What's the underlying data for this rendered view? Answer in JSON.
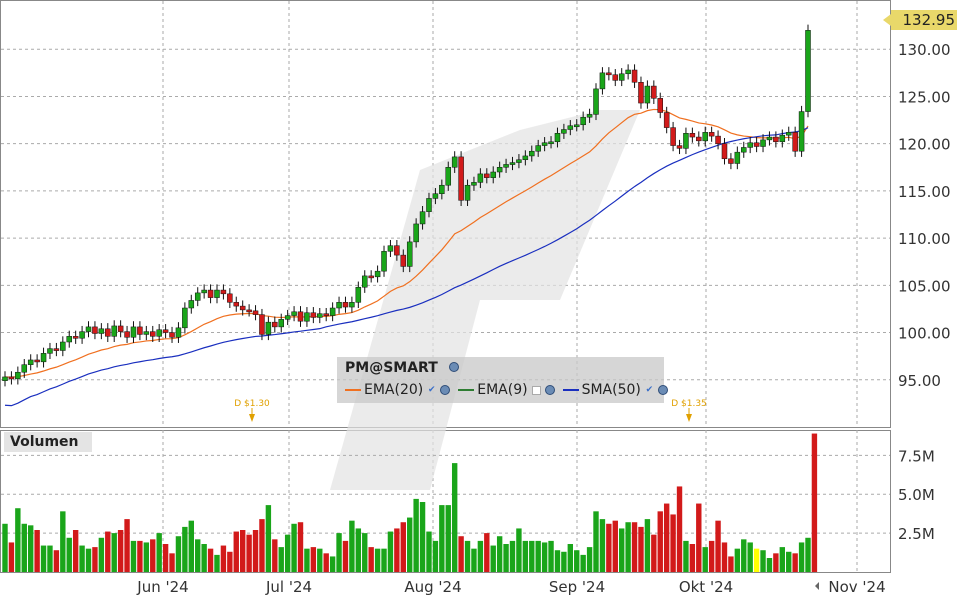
{
  "chart_data": [
    {
      "type": "candlestick",
      "symbol": "PM@SMART",
      "last_price_label": "132.95",
      "ylim": [
        90,
        135
      ],
      "y_ticks": [
        "95.00",
        "100.00",
        "105.00",
        "110.00",
        "115.00",
        "120.00",
        "125.00",
        "130.00"
      ],
      "x_ticks": [
        "Jun '24",
        "Jul '24",
        "Aug '24",
        "Sep '24",
        "Okt '24",
        "Nov '24"
      ],
      "series": [
        {
          "name": "EMA(20)",
          "color": "#f07020",
          "checked": true
        },
        {
          "name": "EMA(9)",
          "color": "#2e7d32",
          "checked": false
        },
        {
          "name": "SMA(50)",
          "color": "#1a2fbf",
          "checked": true
        }
      ],
      "dividends": [
        "D $1.30",
        "D $1.35"
      ],
      "closes": [
        95.3,
        95.1,
        95.8,
        96.6,
        97.1,
        96.9,
        97.8,
        98.3,
        98.1,
        99.0,
        99.6,
        99.4,
        100.1,
        100.6,
        99.9,
        100.4,
        99.6,
        100.7,
        100.1,
        99.5,
        100.6,
        99.8,
        100.1,
        99.6,
        100.3,
        100.0,
        99.5,
        100.5,
        102.6,
        103.4,
        104.2,
        104.5,
        103.7,
        104.5,
        104.1,
        103.2,
        102.8,
        102.4,
        102.3,
        101.9,
        99.8,
        101.1,
        100.6,
        101.4,
        101.8,
        102.2,
        101.2,
        102.1,
        101.6,
        102.0,
        101.8,
        102.6,
        103.2,
        102.7,
        103.2,
        104.8,
        106.0,
        105.9,
        106.5,
        108.6,
        109.2,
        108.2,
        107.0,
        109.6,
        111.5,
        112.8,
        114.2,
        114.7,
        115.6,
        117.5,
        118.6,
        114.0,
        115.6,
        115.9,
        116.8,
        116.4,
        117.0,
        117.5,
        117.8,
        118.0,
        118.3,
        118.7,
        119.2,
        119.8,
        120.1,
        120.2,
        121.1,
        121.5,
        121.9,
        122.0,
        122.8,
        123.1,
        125.8,
        127.5,
        127.3,
        126.7,
        127.4,
        127.8,
        126.5,
        124.3,
        126.1,
        124.8,
        123.3,
        121.7,
        119.8,
        119.5,
        121.1,
        120.7,
        120.3,
        121.2,
        120.8,
        120.0,
        118.4,
        117.9,
        119.1,
        119.6,
        120.1,
        119.7,
        120.4,
        120.7,
        120.2,
        120.9,
        121.2,
        119.2,
        123.4,
        132.0
      ]
    },
    {
      "type": "bar",
      "title": "Volumen",
      "y_ticks": [
        "2.5M",
        "5.0M",
        "7.5M"
      ],
      "ylim": [
        0,
        9.0
      ],
      "unit": "M",
      "values": [
        3.1,
        1.9,
        4.1,
        3.1,
        3.0,
        2.7,
        1.7,
        1.7,
        1.4,
        3.9,
        2.2,
        2.7,
        1.7,
        1.5,
        1.6,
        2.2,
        2.6,
        2.5,
        2.7,
        3.4,
        2.0,
        2.0,
        1.9,
        2.1,
        2.5,
        1.8,
        1.2,
        2.3,
        2.9,
        3.3,
        2.1,
        1.8,
        1.5,
        1.1,
        1.7,
        1.3,
        2.6,
        2.7,
        2.4,
        2.7,
        3.4,
        4.3,
        2.1,
        1.6,
        2.4,
        3.1,
        3.2,
        1.5,
        1.6,
        1.5,
        1.2,
        1.0,
        2.5,
        2.0,
        3.3,
        2.8,
        2.5,
        1.6,
        1.5,
        1.5,
        2.6,
        2.8,
        3.2,
        3.5,
        4.7,
        4.5,
        2.6,
        2.0,
        4.3,
        4.3,
        7.0,
        2.3,
        2.0,
        1.5,
        2.0,
        2.5,
        1.7,
        2.3,
        1.8,
        2.0,
        2.8,
        2.0,
        2.0,
        2.0,
        1.9,
        2.0,
        1.4,
        1.3,
        1.8,
        1.4,
        1.1,
        1.6,
        3.9,
        3.4,
        3.1,
        3.3,
        2.8,
        3.2,
        3.2,
        2.9,
        3.4,
        2.4,
        3.9,
        4.4,
        3.7,
        5.5,
        2.0,
        1.8,
        4.4,
        1.6,
        2.0,
        3.3,
        1.9,
        1.0,
        1.5,
        2.1,
        1.9,
        1.5,
        1.4,
        0.9,
        1.2,
        1.6,
        1.3,
        1.2,
        1.9,
        2.2,
        8.9
      ],
      "up_color": "#1aa51a",
      "down_color": "#d21a1a",
      "highlight_color": "#ffff00"
    }
  ],
  "labels": {
    "legend_title": "PM@SMART",
    "legend_ema20": "EMA(20)",
    "legend_ema9": "EMA(9)",
    "legend_sma50": "SMA(50)",
    "volume_title": "Volumen",
    "price_tag": "132.95",
    "div1": "D $1.30",
    "div2": "D $1.35"
  }
}
